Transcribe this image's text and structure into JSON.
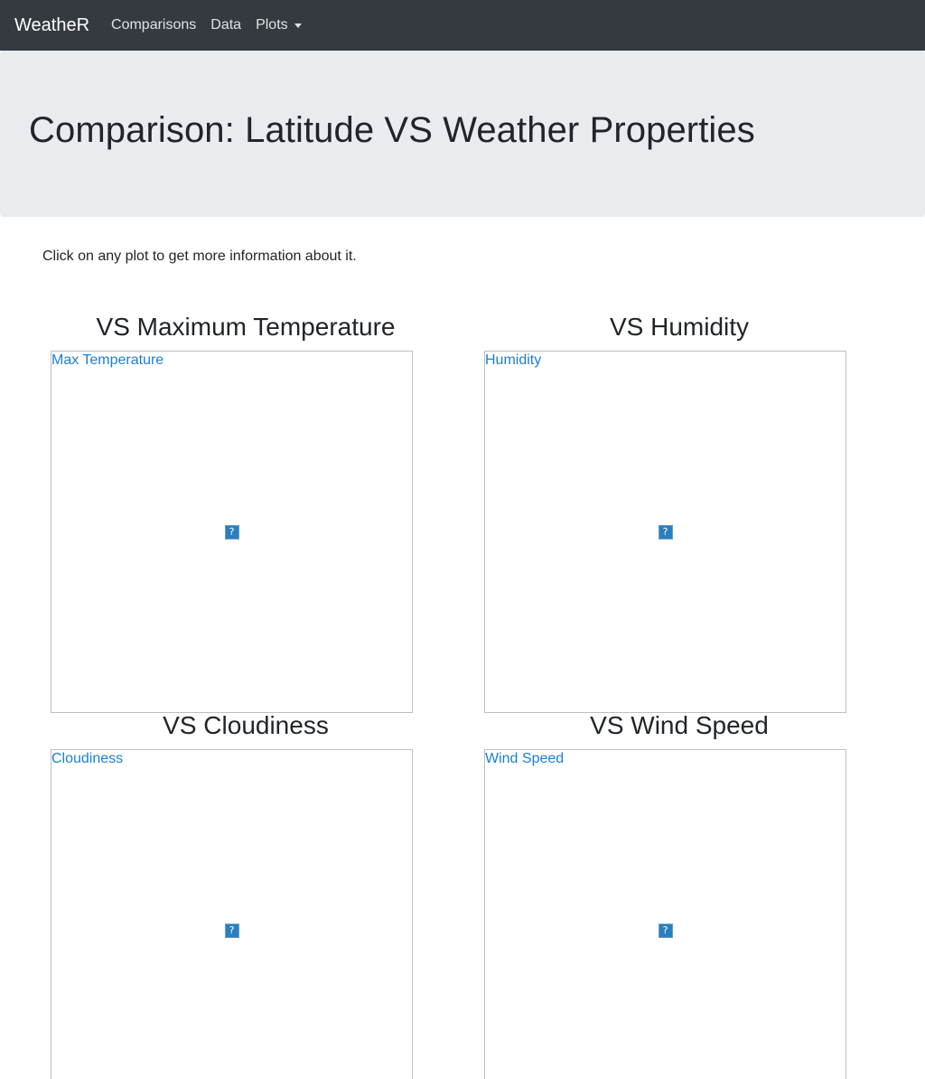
{
  "navbar": {
    "brand": "WeatheR",
    "links": [
      "Comparisons",
      "Data"
    ],
    "dropdown_label": "Plots"
  },
  "header": {
    "title": "Comparison: Latitude VS Weather Properties"
  },
  "intro": {
    "text": "Click on any plot to get more information about it."
  },
  "plots": [
    {
      "heading": "VS Maximum Temperature",
      "alt": "Max Temperature",
      "icon": "broken-image-icon"
    },
    {
      "heading": "VS Humidity",
      "alt": "Humidity",
      "icon": "broken-image-icon"
    },
    {
      "heading": "VS Cloudiness",
      "alt": "Cloudiness",
      "icon": "broken-image-icon"
    },
    {
      "heading": "VS Wind Speed",
      "alt": "Wind Speed",
      "icon": "broken-image-icon"
    }
  ],
  "broken_icon_glyph": "?"
}
